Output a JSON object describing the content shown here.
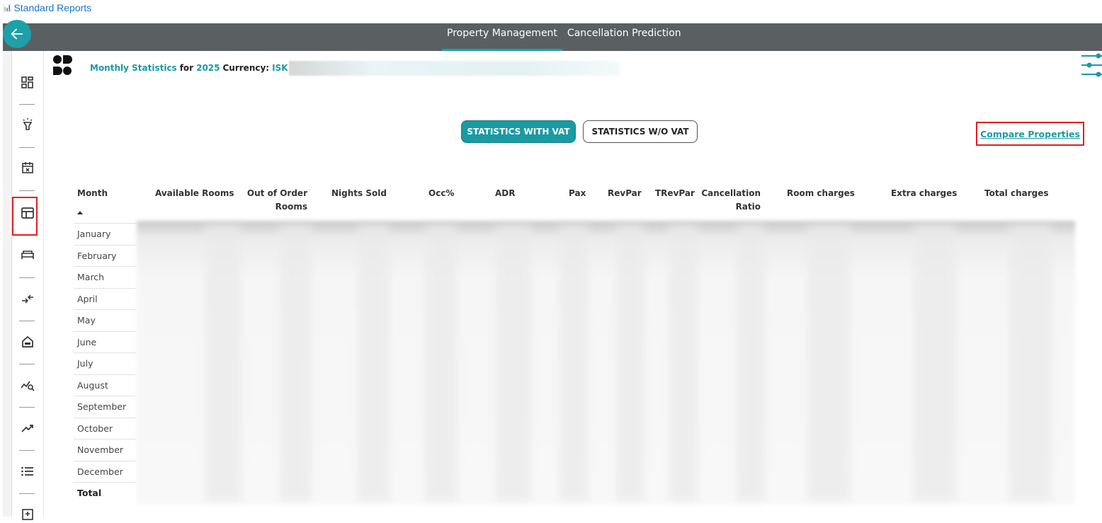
{
  "top_link": {
    "label": "Standard Reports"
  },
  "nav": {
    "tabs": [
      {
        "label": "Property Management",
        "active": true
      },
      {
        "label": "Cancellation Prediction",
        "active": false
      }
    ]
  },
  "header": {
    "report_name": "Monthly Statistics",
    "for_word": "for",
    "year": "2025",
    "currency_label": "Currency:",
    "currency": "ISK"
  },
  "buttons": {
    "with_vat": "STATISTICS WITH VAT",
    "without_vat": "STATISTICS W/O VAT",
    "compare": "Compare Properties"
  },
  "table": {
    "columns": [
      "Month",
      "Available Rooms",
      "Out of Order Rooms",
      "Nights Sold",
      "Occ%",
      "ADR",
      "Pax",
      "RevPar",
      "TRevPar",
      "Cancellation Ratio",
      "Room charges",
      "Extra charges",
      "Total charges"
    ],
    "months": [
      "January",
      "February",
      "March",
      "April",
      "May",
      "June",
      "July",
      "August",
      "September",
      "October",
      "November",
      "December"
    ],
    "total_label": "Total"
  },
  "colors": {
    "accent": "#1a9aa3",
    "navbar": "#5a5f61",
    "highlight": "#e02020"
  }
}
